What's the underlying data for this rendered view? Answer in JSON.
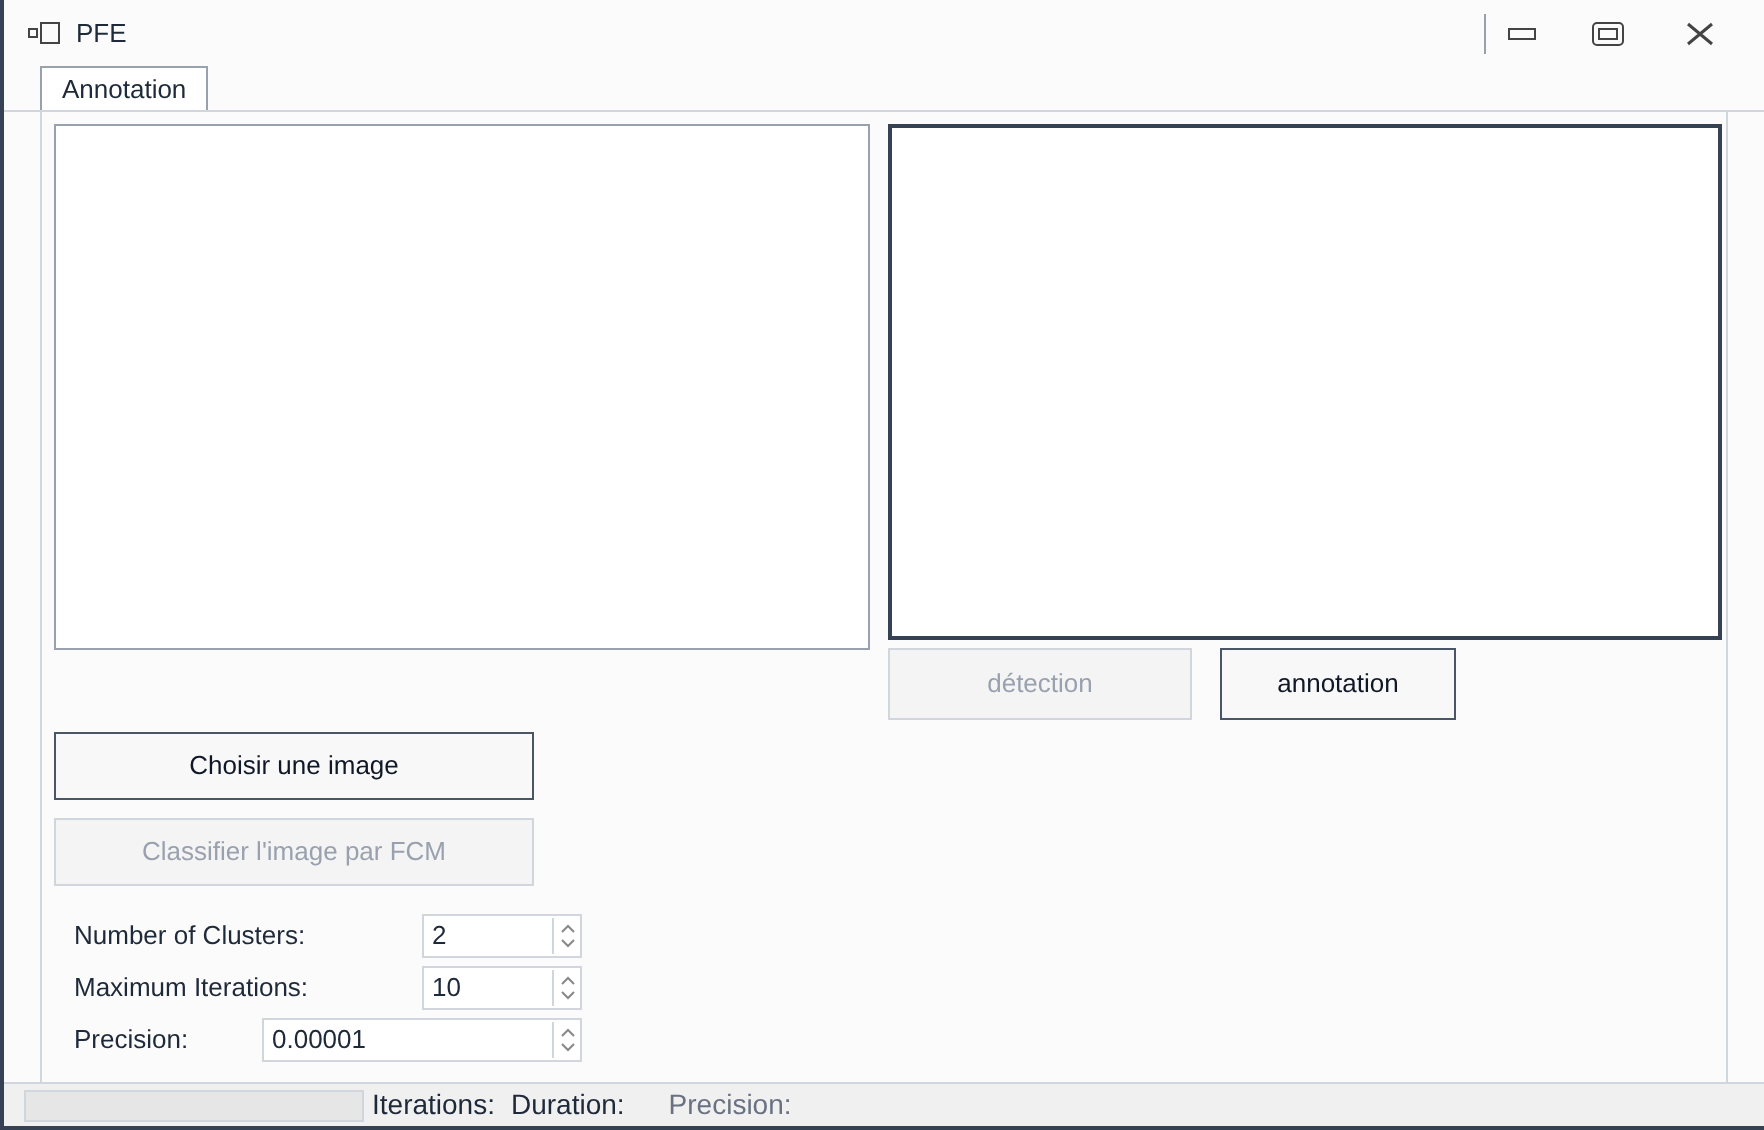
{
  "window": {
    "title": "PFE"
  },
  "tabs": [
    {
      "label": "Annotation",
      "selected": true
    }
  ],
  "action_buttons": [
    {
      "label": "détection",
      "disabled": true
    },
    {
      "label": "annotation",
      "disabled": false
    }
  ],
  "left_buttons": [
    {
      "label": "Choisir une image",
      "disabled": false
    },
    {
      "label": "Classifier l'image par FCM",
      "disabled": true
    }
  ],
  "parameters": [
    {
      "label": "Number of Clusters:",
      "value": "2",
      "kind": "short"
    },
    {
      "label": "Maximum Iterations:",
      "value": "10",
      "kind": "short"
    },
    {
      "label": "Precision:",
      "value": "0.00001",
      "kind": "wide"
    }
  ],
  "status_bar": {
    "labels": [
      "Iterations:",
      "Duration:",
      "Precision:"
    ]
  }
}
